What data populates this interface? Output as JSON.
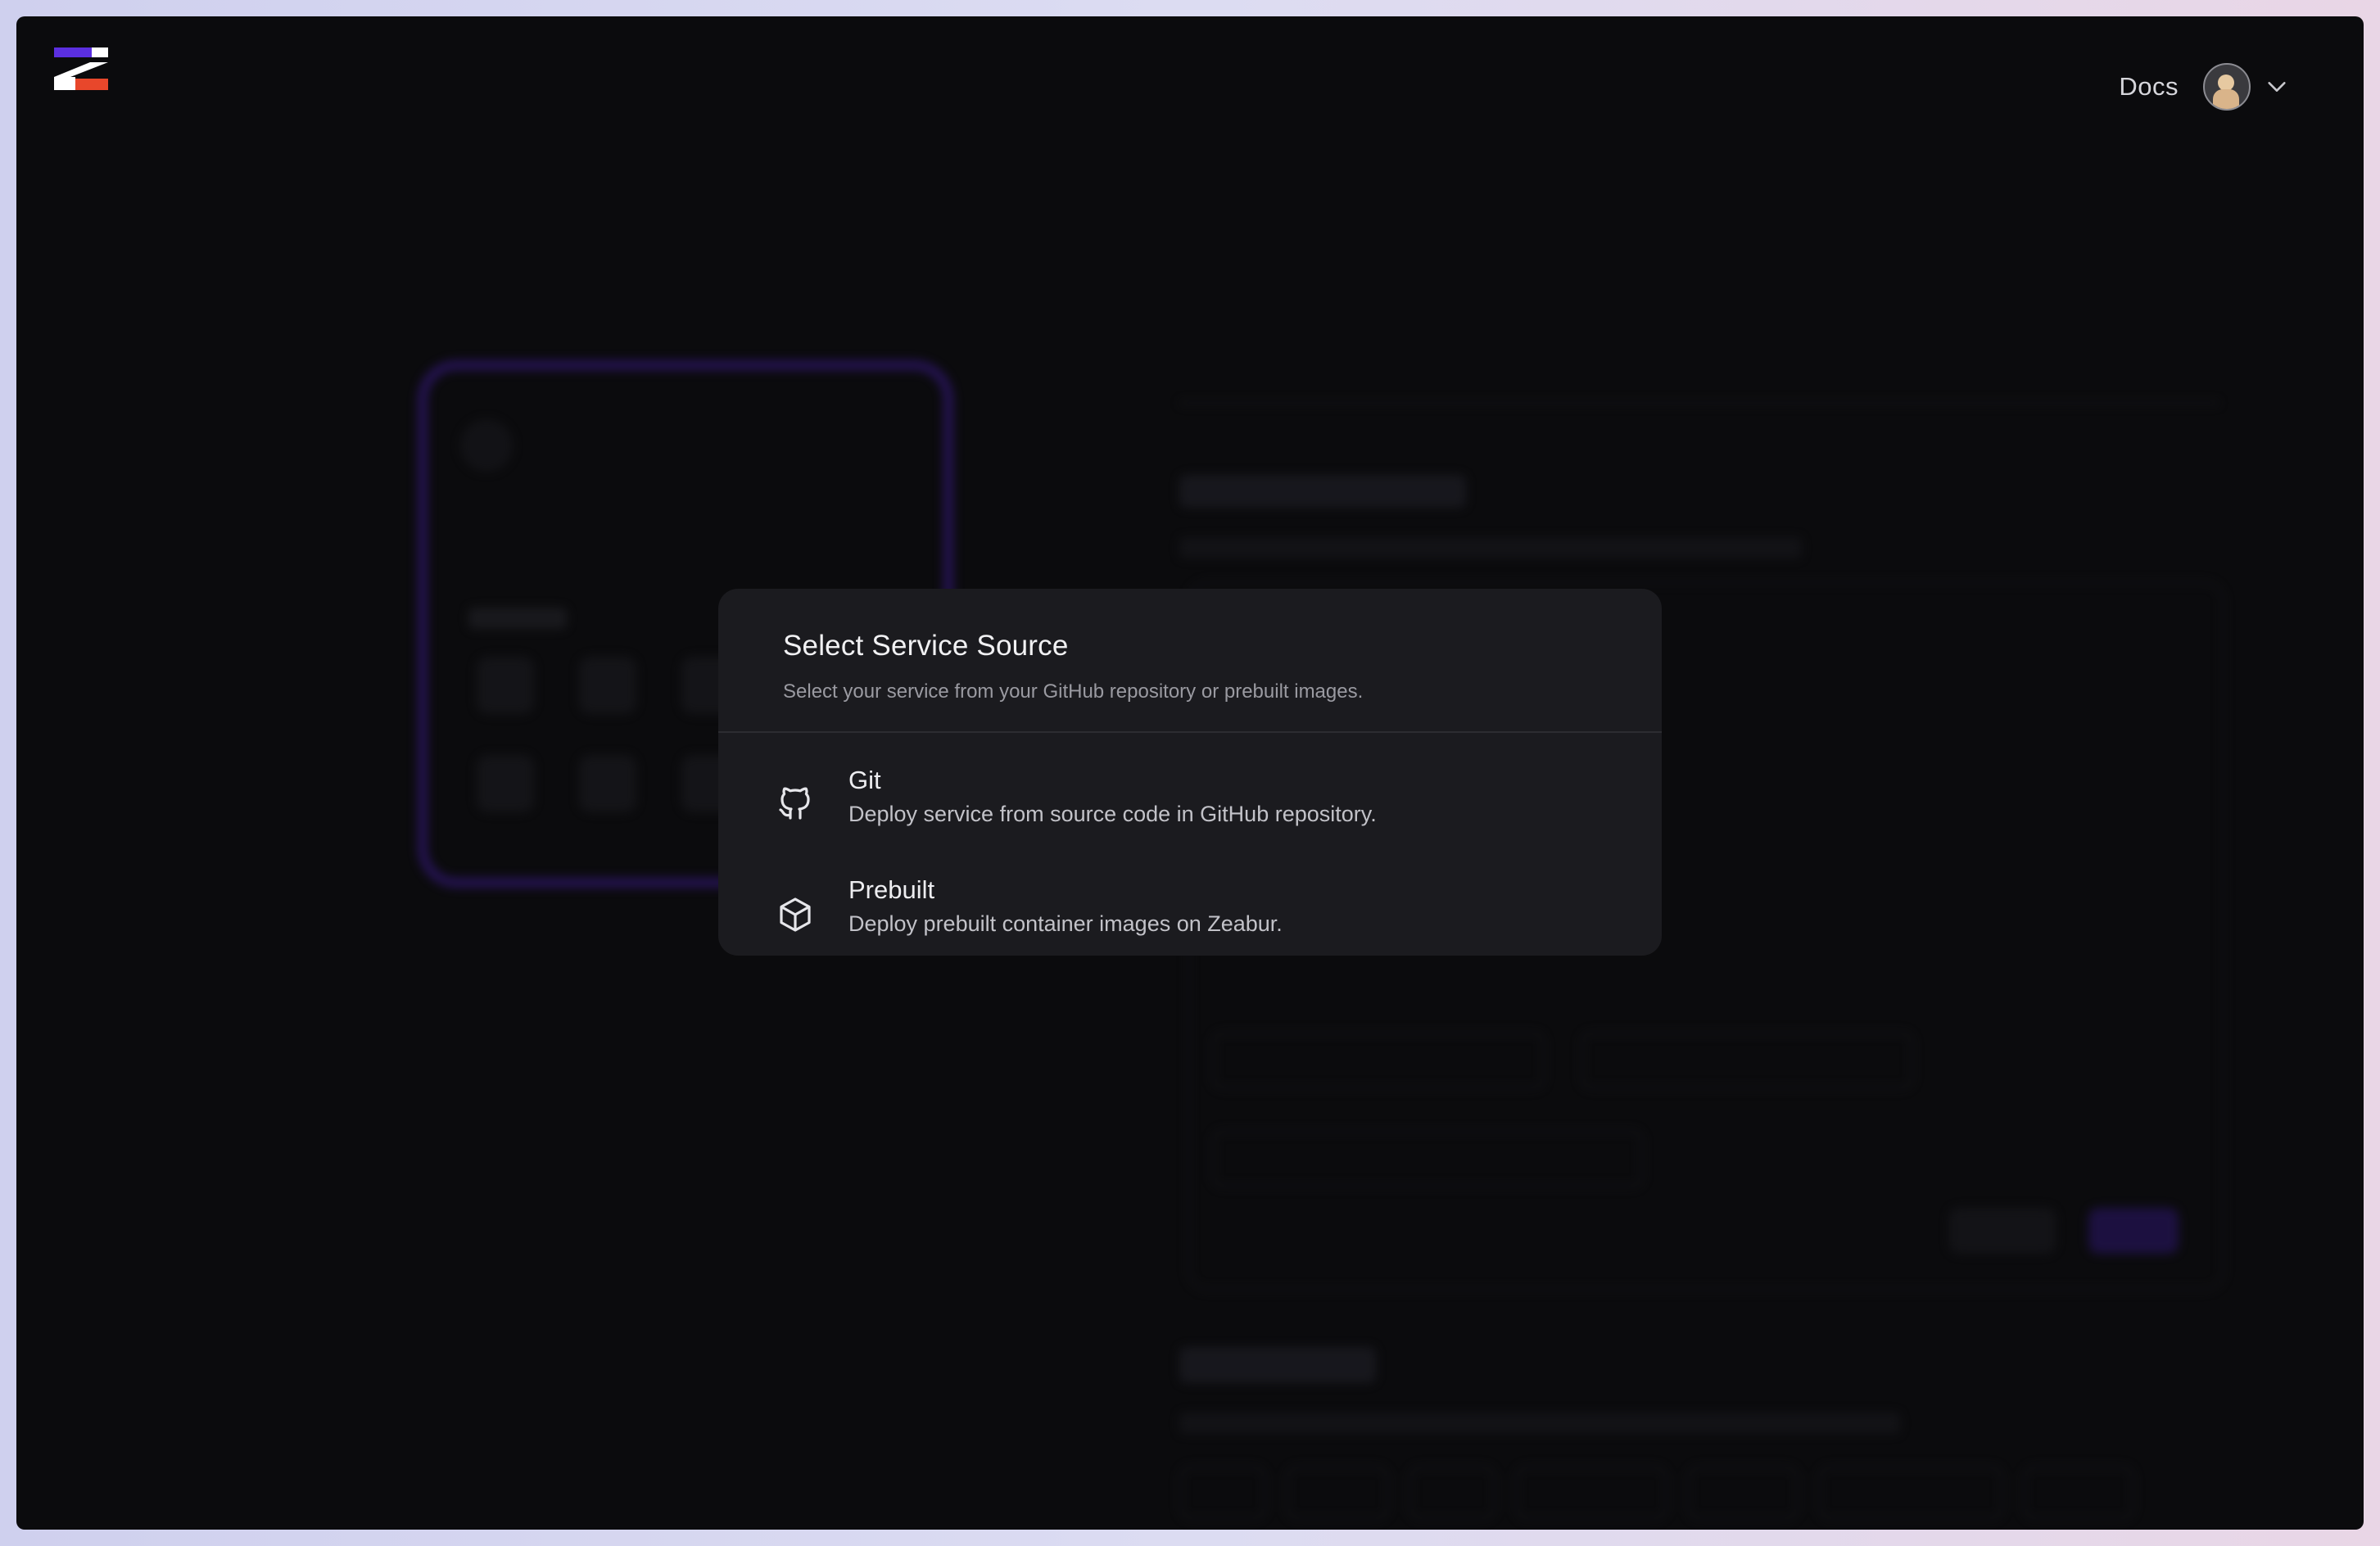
{
  "header": {
    "docs_label": "Docs"
  },
  "modal": {
    "title": "Select Service Source",
    "description": "Select your service from your GitHub repository or prebuilt images.",
    "options": [
      {
        "title": "Git",
        "description": "Deploy service from source code in GitHub repository.",
        "icon": "github-icon"
      },
      {
        "title": "Prebuilt",
        "description": "Deploy prebuilt container images on Zeabur.",
        "icon": "box-icon"
      }
    ]
  },
  "colors": {
    "logo_purple": "#5b2fe0",
    "logo_red": "#e8472b",
    "background": "#0b0b0d",
    "modal": "#1b1b1f"
  }
}
